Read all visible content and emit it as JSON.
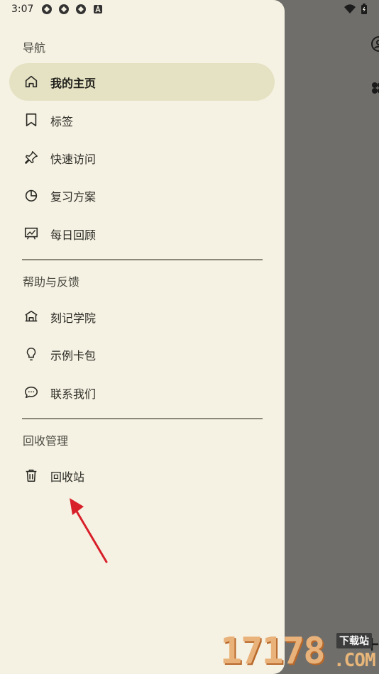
{
  "status_bar": {
    "time": "3:07",
    "icons": [
      "app-icon",
      "app-icon",
      "app-icon",
      "a-icon"
    ],
    "right_icons": [
      "wifi-icon",
      "battery-icon"
    ]
  },
  "drawer": {
    "sections": [
      {
        "header": "导航",
        "items": [
          {
            "label": "我的主页",
            "icon": "home-icon",
            "active": true
          },
          {
            "label": "标签",
            "icon": "bookmark-icon",
            "active": false
          },
          {
            "label": "快速访问",
            "icon": "pin-icon",
            "active": false
          },
          {
            "label": "复习方案",
            "icon": "pie-chart-icon",
            "active": false
          },
          {
            "label": "每日回顾",
            "icon": "presentation-chart-icon",
            "active": false
          }
        ]
      },
      {
        "header": "帮助与反馈",
        "items": [
          {
            "label": "刻记学院",
            "icon": "school-icon",
            "active": false
          },
          {
            "label": "示例卡包",
            "icon": "lightbulb-icon",
            "active": false
          },
          {
            "label": "联系我们",
            "icon": "chat-icon",
            "active": false
          }
        ]
      },
      {
        "header": "回收管理",
        "items": [
          {
            "label": "回收站",
            "icon": "trash-icon",
            "active": false
          }
        ]
      }
    ]
  },
  "colors": {
    "drawer_bg": "#f6f2e3",
    "active_bg": "#e5e2c4",
    "scrim": "#6f6e6a",
    "annotation_arrow": "#d8202a"
  },
  "watermark": {
    "digits": "17178",
    "site": "下载站",
    "domain": ".COM"
  }
}
